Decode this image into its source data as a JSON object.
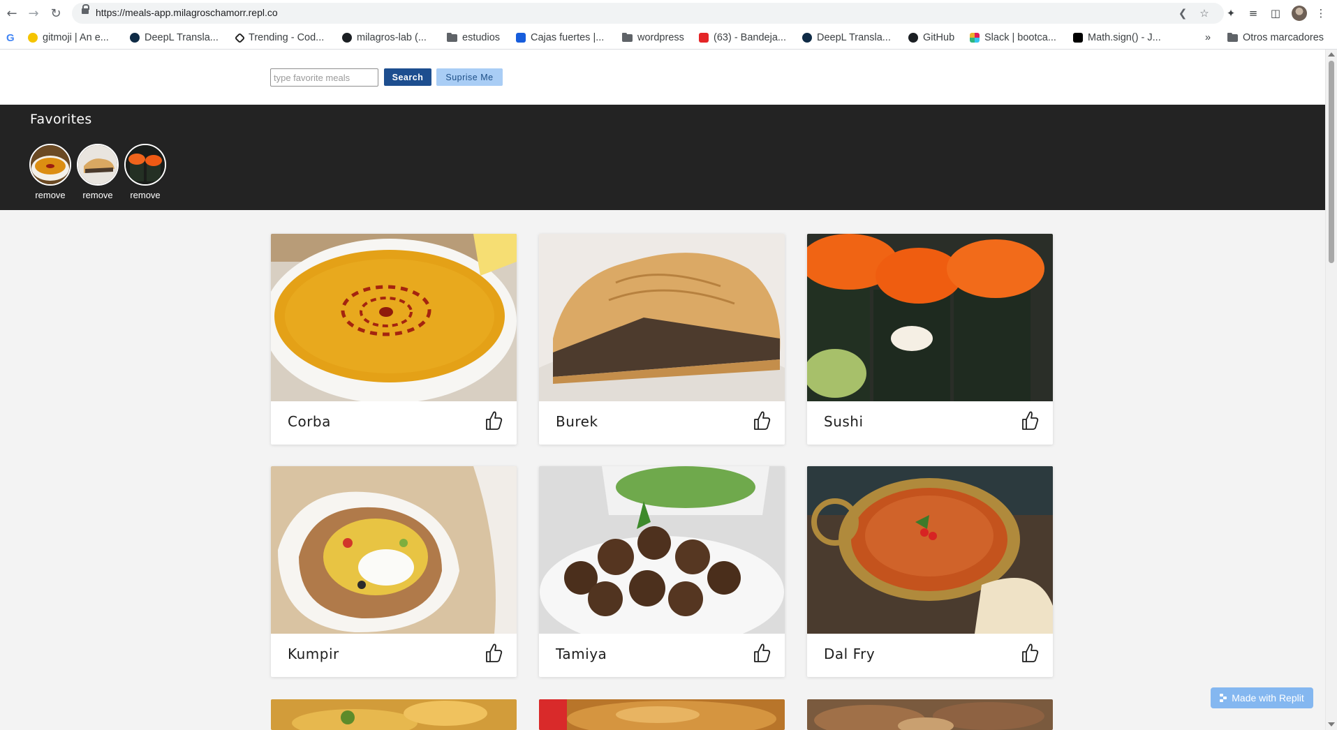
{
  "browser": {
    "url": "https://meals-app.milagroschamorr.repl.co",
    "bookmarks": [
      {
        "label": "gitmoji | An e...",
        "icon": "emoji-face-icon",
        "color": "#f5c400"
      },
      {
        "label": "DeepL Transla...",
        "icon": "deepl-icon",
        "color": "#0f2b46"
      },
      {
        "label": "Trending - Cod...",
        "icon": "codepen-icon",
        "color": "#222222"
      },
      {
        "label": "milagros-lab (...",
        "icon": "github-icon",
        "color": "#1b1f23"
      },
      {
        "label": "estudios",
        "icon": "folder-icon",
        "color": "#5f6368"
      },
      {
        "label": "Cajas fuertes |...",
        "icon": "bitwarden-icon",
        "color": "#175ddc"
      },
      {
        "label": "wordpress",
        "icon": "folder-icon",
        "color": "#5f6368"
      },
      {
        "label": "(63) - Bandeja...",
        "icon": "zoho-mail-icon",
        "color": "#e42527"
      },
      {
        "label": "DeepL Transla...",
        "icon": "deepl-icon",
        "color": "#0f2b46"
      },
      {
        "label": "GitHub",
        "icon": "github-icon",
        "color": "#1b1f23"
      },
      {
        "label": "Slack | bootca...",
        "icon": "slack-icon",
        "color": "#e01e5a"
      },
      {
        "label": "Math.sign() - J...",
        "icon": "mdn-icon",
        "color": "#000000"
      }
    ],
    "more_label": "»",
    "other_bookmarks": "Otros marcadores"
  },
  "search": {
    "placeholder": "type favorite meals",
    "value": "",
    "search_label": "Search",
    "surprise_label": "Suprise Me"
  },
  "favorites": {
    "title": "Favorites",
    "items": [
      {
        "meal": "Corba",
        "remove_label": "remove"
      },
      {
        "meal": "Burek",
        "remove_label": "remove"
      },
      {
        "meal": "Sushi",
        "remove_label": "remove"
      }
    ]
  },
  "meals": [
    {
      "name": "Corba"
    },
    {
      "name": "Burek"
    },
    {
      "name": "Sushi"
    },
    {
      "name": "Kumpir"
    },
    {
      "name": "Tamiya"
    },
    {
      "name": "Dal Fry"
    }
  ],
  "badge": {
    "label": "Made with Replit"
  },
  "colors": {
    "search_button": "#1d4e8f",
    "surprise_button": "#a9cdf5",
    "favorites_bg": "#232323",
    "page_bg": "#f3f3f3"
  }
}
